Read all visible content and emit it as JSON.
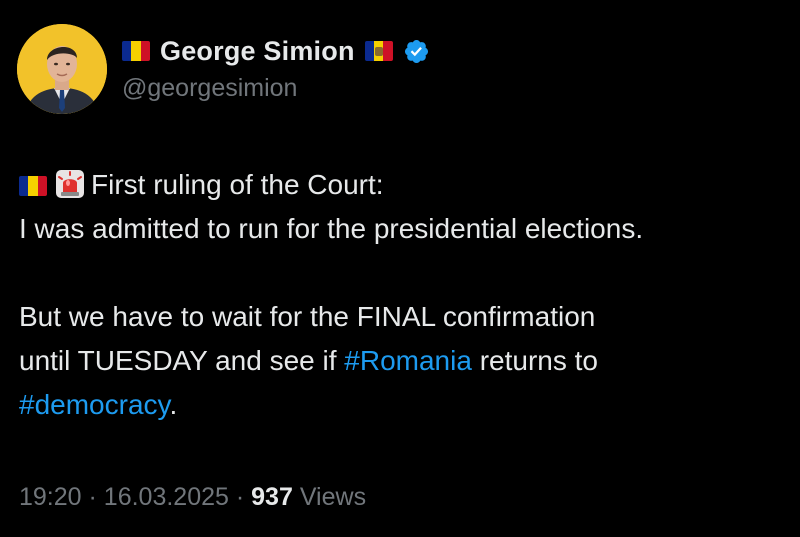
{
  "author": {
    "display_name": "George Simion",
    "handle": "@georgesimion",
    "verified": true,
    "avatar_icon": "avatar-photo",
    "name_prefix_icon": "romania-flag-icon",
    "name_suffix_icon": "moldova-flag-icon"
  },
  "tweet": {
    "line1": "First ruling of the Court:",
    "line2": "I was admitted to run for the presidential elections.",
    "line3": "But we have to wait for the FINAL confirmation",
    "line4_before": "until TUESDAY and see if",
    "hashtag_romania": "#Romania",
    "line4_after": "returns to",
    "hashtag_democracy": "#democracy",
    "line5_after": ".",
    "lead_icons": [
      "romania-flag-icon",
      "siren-icon"
    ]
  },
  "meta": {
    "time": "19:20",
    "separator": "·",
    "date": "16.03.2025",
    "views_count": "937",
    "views_label": "Views"
  },
  "colors": {
    "background": "#000000",
    "text": "#e7e9ea",
    "secondary": "#71767b",
    "link": "#1d9bf0",
    "verified": "#1d9bf0",
    "avatar_bg": "#f2c22a"
  }
}
